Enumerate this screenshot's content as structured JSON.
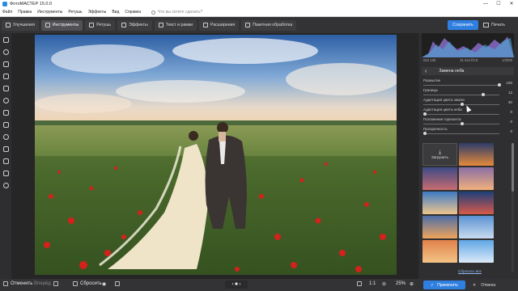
{
  "window": {
    "title": "ФотоМАСТЕР 15.0.0",
    "controls": [
      "—",
      "☐",
      "✕"
    ]
  },
  "menu": {
    "items": [
      "Файл",
      "Правка",
      "Инструменты",
      "Ретушь",
      "Эффекты",
      "Вид",
      "Справка"
    ],
    "search_placeholder": "Что вы хотите сделать?"
  },
  "toolbar": {
    "tabs": [
      {
        "label": "Улучшения",
        "icon": "enhance-icon"
      },
      {
        "label": "Инструменты",
        "icon": "tools-icon",
        "active": true
      },
      {
        "label": "Ретушь",
        "icon": "retouch-icon"
      },
      {
        "label": "Эффекты",
        "icon": "effects-icon"
      },
      {
        "label": "Текст и рамки",
        "icon": "text-icon"
      },
      {
        "label": "Расширения",
        "icon": "plus-icon"
      },
      {
        "label": "Пакетная обработка",
        "icon": "batch-icon"
      }
    ],
    "save_label": "Сохранить",
    "print_label": "Печать"
  },
  "histogram": {
    "iso": "ISO 100",
    "focal": "31 mm f/2.8",
    "shutter": "1/2000"
  },
  "panel": {
    "title": "Замена неба",
    "sliders": [
      {
        "label": "Размытие",
        "value": "100",
        "fraction": 1.0
      },
      {
        "label": "Граница",
        "value": "13",
        "fraction": 0.78
      },
      {
        "label": "Адаптация цвета земли",
        "value": "30",
        "fraction": 0.5
      },
      {
        "label": "Адаптация цвета неба",
        "value": "0",
        "fraction": 0.0
      },
      {
        "label": "Положение горизонта",
        "value": "0",
        "fraction": 0.5
      },
      {
        "label": "Прозрачность",
        "value": "0",
        "fraction": 0.0
      }
    ],
    "upload_label": "Загрузить",
    "clear_all": "Сбросить все"
  },
  "bottombar": {
    "undo": "Отменить",
    "redo": "Вперёд",
    "reset": "Сбросить",
    "zoom_ratio": "1:1",
    "zoom_percent": "25%",
    "apply": "Применить",
    "cancel": "Отмена"
  },
  "colors": {
    "accent": "#2f7fe0",
    "bg_dark": "#2b2b2b"
  }
}
